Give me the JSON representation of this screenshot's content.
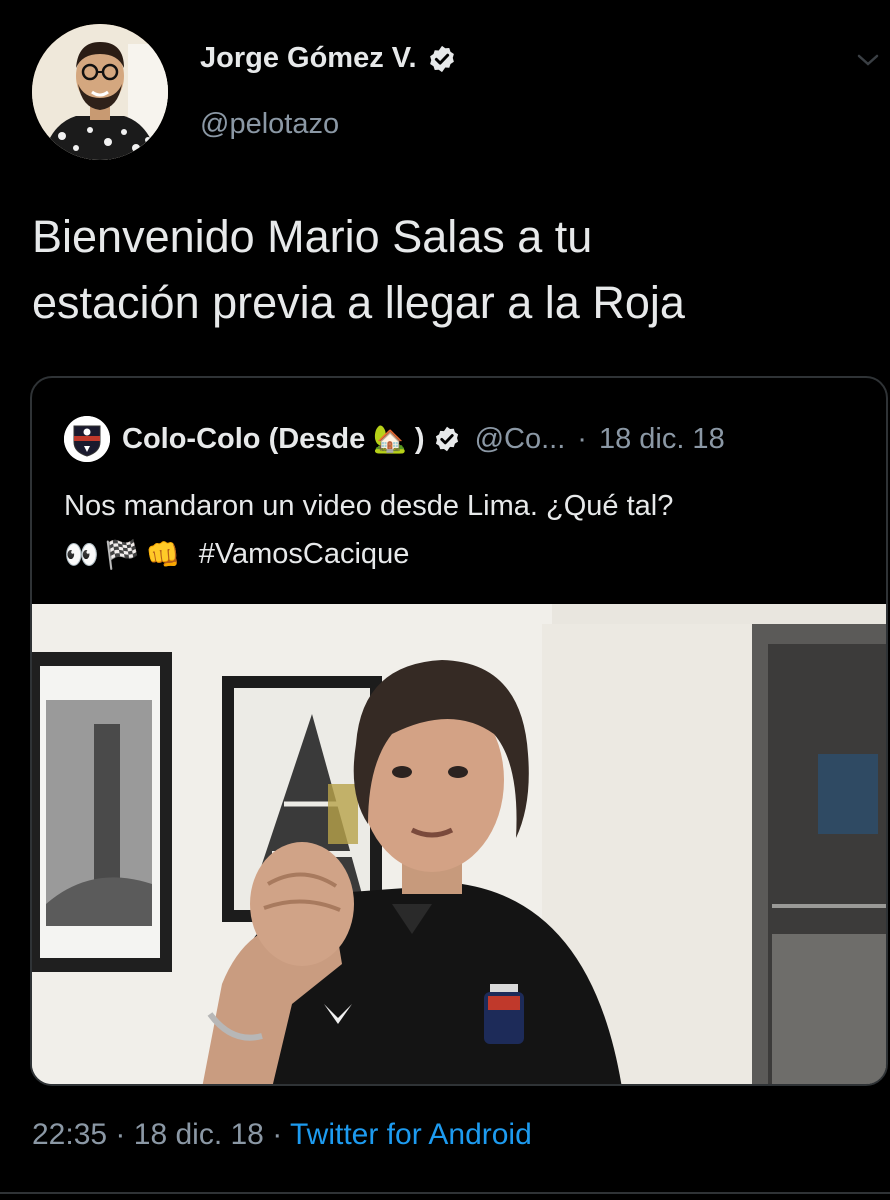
{
  "author": {
    "name": "Jorge Gómez V.",
    "handle": "@pelotazo",
    "verified_icon": "verified-badge-icon",
    "avatar_icon": "author-avatar"
  },
  "tweet": {
    "text_line1": "Bienvenido Mario Salas a tu",
    "text_line2": "estación previa a llegar a la Roja"
  },
  "quoted": {
    "name": "Colo-Colo (Desde",
    "name_emoji": "🏡",
    "name_close": ")",
    "handle": "@Co...",
    "separator": "·",
    "date": "18 dic. 18",
    "text_line1": "Nos mandaron un video desde Lima. ¿Qué tal?",
    "emojis": [
      "👀",
      "🏁",
      "👊"
    ],
    "hashtag": "#VamosCacique",
    "media": "video-thumbnail"
  },
  "meta": {
    "time": "22:35",
    "sep1": "·",
    "date": "18 dic. 18",
    "sep2": "·",
    "source": "Twitter for Android"
  },
  "colors": {
    "background": "#000000",
    "text": "#e7e9ea",
    "muted": "#8b98a5",
    "link": "#1d9bf0",
    "border": "#2f3336"
  }
}
